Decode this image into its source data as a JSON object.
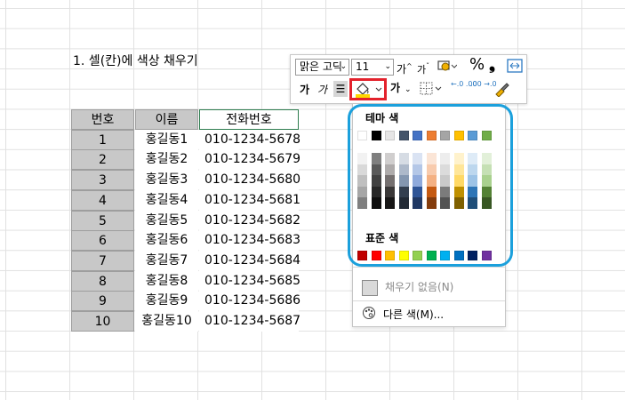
{
  "heading": "1. 셀(칸)에 색상 채우기",
  "table": {
    "headers": [
      "번호",
      "이름",
      "전화번호"
    ],
    "rows": [
      [
        "1",
        "홍길동1",
        "010-1234-5678"
      ],
      [
        "2",
        "홍길동2",
        "010-1234-5679"
      ],
      [
        "3",
        "홍길동3",
        "010-1234-5680"
      ],
      [
        "4",
        "홍길동4",
        "010-1234-5681"
      ],
      [
        "5",
        "홍길동5",
        "010-1234-5682"
      ],
      [
        "6",
        "홍길동6",
        "010-1234-5683"
      ],
      [
        "7",
        "홍길동7",
        "010-1234-5684"
      ],
      [
        "8",
        "홍길동8",
        "010-1234-5685"
      ],
      [
        "9",
        "홍길동9",
        "010-1234-5686"
      ],
      [
        "10",
        "홍길동10",
        "010-1234-5687"
      ]
    ]
  },
  "mini_toolbar": {
    "font_name": "맑은 고딕",
    "font_size": "11",
    "grow_font": "가",
    "shrink_font": "가",
    "percent": "%",
    "comma": "❟",
    "bold": "가",
    "italic": "가",
    "font_color": "가",
    "decrease_decimal": "←.0 .00",
    "increase_decimal": ".00 →.0"
  },
  "color_picker": {
    "theme_label": "테마 색",
    "standard_label": "표준 색",
    "no_fill_label": "채우기 없음(N)",
    "more_colors_label": "다른 색(M)...",
    "theme_colors": [
      "#ffffff",
      "#000000",
      "#e7e6e6",
      "#44546a",
      "#4472c4",
      "#ed7d31",
      "#a5a5a5",
      "#ffc000",
      "#5b9bd5",
      "#70ad47"
    ],
    "theme_shades": [
      [
        "#f2f2f2",
        "#d9d9d9",
        "#bfbfbf",
        "#a6a6a6",
        "#7f7f7f"
      ],
      [
        "#7f7f7f",
        "#595959",
        "#404040",
        "#262626",
        "#0d0d0d"
      ],
      [
        "#d0cece",
        "#aeabab",
        "#757070",
        "#3a3838",
        "#171616"
      ],
      [
        "#d6dce4",
        "#adb9ca",
        "#8497b0",
        "#333f4f",
        "#222a35"
      ],
      [
        "#dae3f3",
        "#b4c7e7",
        "#8faadc",
        "#2f5597",
        "#203864"
      ],
      [
        "#fbe5d6",
        "#f8cbad",
        "#f4b183",
        "#c55a11",
        "#843c0c"
      ],
      [
        "#ededed",
        "#dbdbdb",
        "#c9c9c9",
        "#7b7b7b",
        "#525252"
      ],
      [
        "#fff2cc",
        "#ffe699",
        "#ffd966",
        "#bf9000",
        "#7f6000"
      ],
      [
        "#deebf7",
        "#bdd7ee",
        "#9dc3e6",
        "#2e75b6",
        "#1f4e79"
      ],
      [
        "#e2f0d9",
        "#c5e0b4",
        "#a9d18e",
        "#548235",
        "#385723"
      ]
    ],
    "standard_colors": [
      "#c00000",
      "#ff0000",
      "#ffc000",
      "#ffff00",
      "#92d050",
      "#00b050",
      "#00b0f0",
      "#0070c0",
      "#002060",
      "#7030a0"
    ],
    "accent_highlight": "#1ba0dc",
    "fill_button_highlight": "#e3222c"
  }
}
